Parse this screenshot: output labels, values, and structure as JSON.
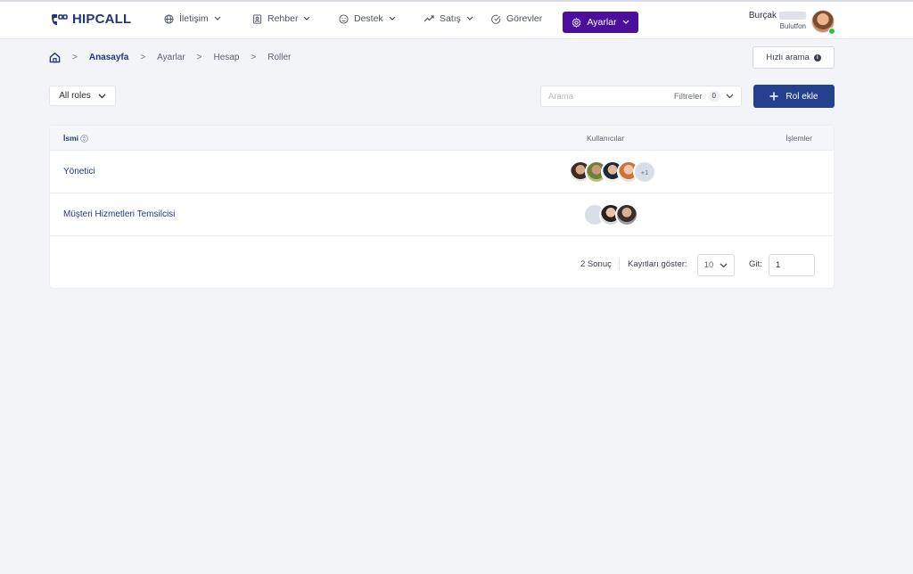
{
  "app": {
    "logo_text": "HIPCALL"
  },
  "nav": {
    "items": [
      {
        "label": "İletişim",
        "icon": "globe-icon"
      },
      {
        "label": "Rehber",
        "icon": "contact-book-icon"
      },
      {
        "label": "Destek",
        "icon": "smile-icon"
      },
      {
        "label": "Satış",
        "icon": "trend-icon"
      },
      {
        "label": "Görevler",
        "icon": "check-circle-icon"
      }
    ],
    "active": {
      "label": "Ayarlar",
      "icon": "gear-icon"
    }
  },
  "user": {
    "name": "Burçak",
    "company": "Bulutfon",
    "status_color": "#2fbf4f"
  },
  "breadcrumb": {
    "items": [
      "Anasayfa",
      "Ayarlar",
      "Hesap",
      "Roller"
    ]
  },
  "quick_search": {
    "label": "Hızlı arama"
  },
  "roles_filter": {
    "selected": "All roles"
  },
  "search": {
    "placeholder": "Arama",
    "value": ""
  },
  "filters": {
    "label": "Filtreler",
    "count": "0"
  },
  "add_role": {
    "label": "Rol ekle"
  },
  "table": {
    "columns": {
      "name": "İsmi",
      "users": "Kullanıcılar",
      "actions": "İşlemler"
    },
    "rows": [
      {
        "name": "Yönetici",
        "extra_users": "+1"
      },
      {
        "name": "Müşteri Hizmetleri Temsilcisi"
      }
    ]
  },
  "pagination": {
    "result_text": "2 Sonuç",
    "show_label": "Kayıtları göster:",
    "page_size": "10",
    "go_label": "Git:",
    "go_value": "1"
  },
  "colors": {
    "brand": "#24367d",
    "active_nav": "#4a0f9c",
    "primary_button": "#24408f",
    "background": "#f2f4f8"
  }
}
